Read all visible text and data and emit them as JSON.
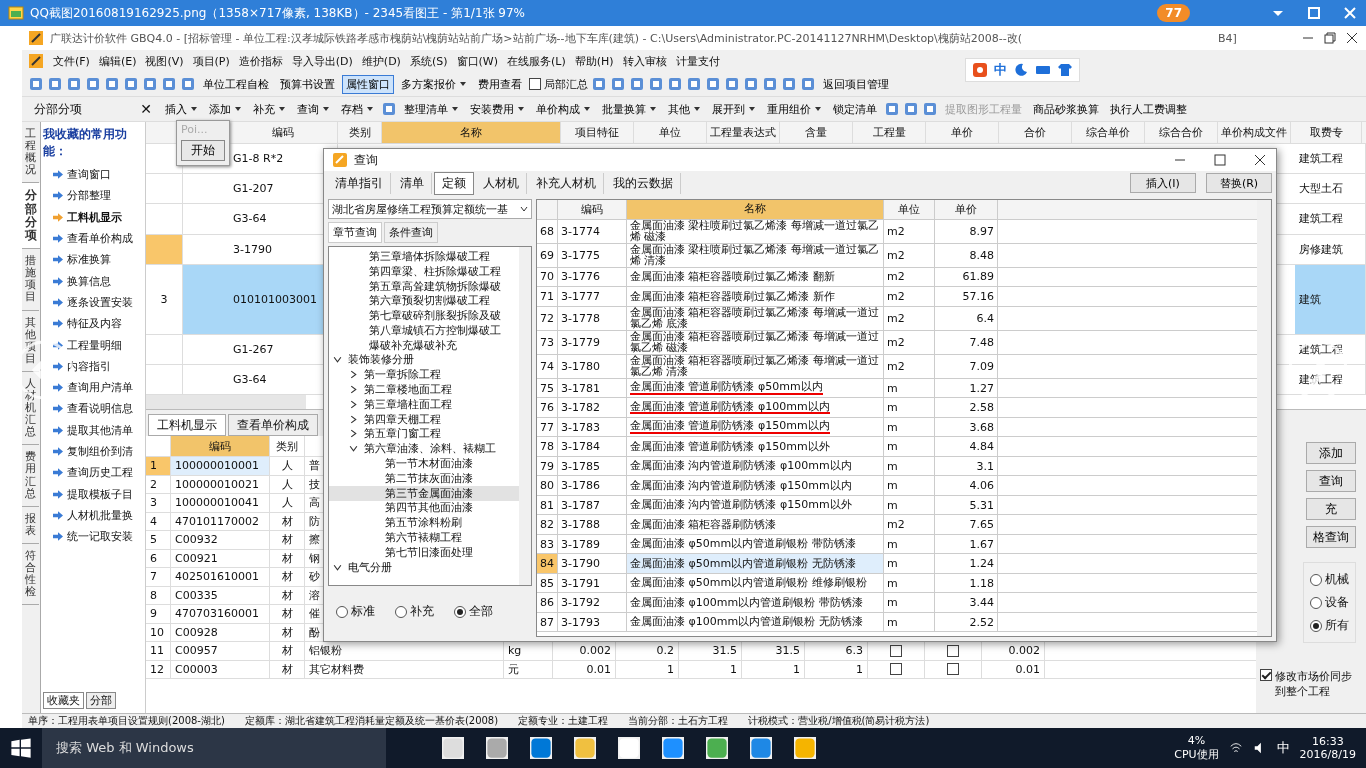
{
  "viewer": {
    "title": "QQ截图20160819162925.png（1358×717像素, 138KB）- 2345看图王 - 第1/1张 97%",
    "badge": "77"
  },
  "app": {
    "title": "广联达计价软件 GBQ4.0 - [招标管理 - 单位工程:汉孝城际铁路孝感市槐荫站\\槐荫站站前广场>站前广场--地下车库(建筑) - C:\\Users\\Administrator.PC-20141127NRHM\\Desktop\\槐荫站2008--改(",
    "title_tail": "B4]"
  },
  "ime": {
    "label": "中"
  },
  "menu": [
    "文件(F)",
    "编辑(E)",
    "视图(V)",
    "项目(P)",
    "造价指标",
    "导入导出(D)",
    "维护(D)",
    "系统(S)",
    "窗口(W)",
    "在线服务(L)",
    "帮助(H)",
    "转入审核",
    "计量支付"
  ],
  "toolbar1": [
    {
      "kind": "icon"
    },
    {
      "kind": "icon"
    },
    {
      "kind": "icon"
    },
    {
      "kind": "icon"
    },
    {
      "kind": "icon"
    },
    {
      "kind": "icon"
    },
    {
      "kind": "icon"
    },
    {
      "kind": "icon"
    },
    {
      "kind": "icon"
    },
    {
      "kind": "button",
      "label": "单位工程自检",
      "selected": false
    },
    {
      "kind": "button",
      "label": "预算书设置",
      "selected": false
    },
    {
      "kind": "button",
      "label": "属性窗口",
      "selected": true
    },
    {
      "kind": "dropdown",
      "label": "多方案报价"
    },
    {
      "kind": "button",
      "label": "费用查看",
      "selected": false
    },
    {
      "kind": "check",
      "label": "局部汇总",
      "checked": false
    },
    {
      "kind": "icon"
    },
    {
      "kind": "icon"
    },
    {
      "kind": "icon"
    },
    {
      "kind": "icon"
    },
    {
      "kind": "icon"
    },
    {
      "kind": "icon"
    },
    {
      "kind": "icon"
    },
    {
      "kind": "icon"
    },
    {
      "kind": "icon"
    },
    {
      "kind": "icon"
    },
    {
      "kind": "icon"
    },
    {
      "kind": "icon"
    },
    {
      "kind": "button",
      "label": "返回项目管理",
      "selected": false
    }
  ],
  "toolbar2": [
    {
      "kind": "dropdown",
      "label": "插入"
    },
    {
      "kind": "dropdown",
      "label": "添加"
    },
    {
      "kind": "dropdown",
      "label": "补充"
    },
    {
      "kind": "dropdown",
      "label": "查询"
    },
    {
      "kind": "dropdown",
      "label": "存档"
    },
    {
      "kind": "icon"
    },
    {
      "kind": "dropdown",
      "label": "整理清单"
    },
    {
      "kind": "dropdown",
      "label": "安装费用"
    },
    {
      "kind": "dropdown",
      "label": "单价构成"
    },
    {
      "kind": "dropdown",
      "label": "批量换算"
    },
    {
      "kind": "dropdown",
      "label": "其他"
    },
    {
      "kind": "dropdown",
      "label": "展开到"
    },
    {
      "kind": "dropdown",
      "label": "重用组价"
    },
    {
      "kind": "button",
      "label": "锁定清单",
      "disabled": false
    },
    {
      "kind": "icon"
    },
    {
      "kind": "icon"
    },
    {
      "kind": "icon"
    },
    {
      "kind": "button",
      "label": "提取图形工程量",
      "disabled": true
    },
    {
      "kind": "button",
      "label": "商品砂浆换算",
      "disabled": false
    },
    {
      "kind": "button",
      "label": "执行人工费调整",
      "disabled": false
    }
  ],
  "vtabs": [
    {
      "label": "工程概况",
      "selected": false
    },
    {
      "label": "分部分项",
      "selected": true
    },
    {
      "label": "措施项目",
      "selected": false
    },
    {
      "label": "其他项目",
      "selected": false
    },
    {
      "label": "人材机汇总",
      "selected": false
    },
    {
      "label": "费用汇总",
      "selected": false
    },
    {
      "label": "报表",
      "selected": false
    },
    {
      "label": "符合性检",
      "selected": false
    }
  ],
  "sidebar": {
    "header": "分部分项",
    "close": "✕",
    "favorites_title": "我收藏的常用功能：",
    "items": [
      {
        "label": "查询窗口",
        "selected": false
      },
      {
        "label": "分部整理",
        "selected": false
      },
      {
        "label": "工料机显示",
        "selected": true
      },
      {
        "label": "查看单价构成",
        "selected": false
      },
      {
        "label": "标准换算",
        "selected": false
      },
      {
        "label": "换算信息",
        "selected": false
      },
      {
        "label": "逐条设置安装",
        "selected": false
      },
      {
        "label": "特征及内容",
        "selected": false
      },
      {
        "label": "工程量明细",
        "selected": false
      },
      {
        "label": "内容指引",
        "selected": false
      },
      {
        "label": "查询用户清单",
        "selected": false
      },
      {
        "label": "查看说明信息",
        "selected": false
      },
      {
        "label": "提取其他清单",
        "selected": false
      },
      {
        "label": "复制组价到清",
        "selected": false
      },
      {
        "label": "查询历史工程",
        "selected": false
      },
      {
        "label": "提取模板子目",
        "selected": false
      },
      {
        "label": "人材机批量换",
        "selected": false
      },
      {
        "label": "统一记取安装",
        "selected": false
      }
    ],
    "bottom_tabs": [
      {
        "label": "收藏夹",
        "selected": true
      },
      {
        "label": "分部",
        "selected": false
      }
    ]
  },
  "popup": {
    "title": "Poi...",
    "button": "开始"
  },
  "upper_grid": {
    "columns": [
      "编码",
      "类别",
      "名称",
      "项目特征",
      "单位",
      "工程量表达式",
      "含量",
      "工程量",
      "单价",
      "合价",
      "综合单价",
      "综合合价",
      "单价构成文件",
      "取费专"
    ],
    "rows": [
      {
        "num": "",
        "code": "G1-8 R*2",
        "fee": "建筑工程",
        "selected": false,
        "tall": false,
        "marked": false
      },
      {
        "num": "",
        "code": "G1-207",
        "fee": "大型土石",
        "selected": false,
        "tall": false,
        "marked": false
      },
      {
        "num": "",
        "code": "G3-64",
        "fee": "建筑工程",
        "selected": false,
        "tall": false,
        "marked": false
      },
      {
        "num": "",
        "code": "3-1790",
        "fee": "房修建筑",
        "selected": false,
        "tall": false,
        "marked": true
      },
      {
        "num": "3",
        "code": "010101003001",
        "fee": "建筑",
        "selected": true,
        "tall": true,
        "marked": false
      },
      {
        "num": "",
        "code": "G1-267",
        "fee": "建筑工程",
        "selected": false,
        "tall": false,
        "marked": false
      },
      {
        "num": "",
        "code": "G3-64",
        "fee": "建筑工程",
        "selected": false,
        "tall": false,
        "marked": false
      }
    ]
  },
  "lower_tabs": [
    {
      "label": "工料机显示",
      "selected": true
    },
    {
      "label": "查看单价构成",
      "selected": false
    }
  ],
  "lower_grid": {
    "columns": [
      "编码",
      "类别"
    ],
    "rows": [
      {
        "num": "1",
        "code": "100000010001",
        "type": "人",
        "name": "普",
        "selected": true
      },
      {
        "num": "2",
        "code": "100000010021",
        "type": "人",
        "name": "技",
        "selected": false
      },
      {
        "num": "3",
        "code": "100000010041",
        "type": "人",
        "name": "高",
        "selected": false
      },
      {
        "num": "4",
        "code": "470101170002",
        "type": "材",
        "name": "防",
        "selected": false
      },
      {
        "num": "5",
        "code": "C00932",
        "type": "材",
        "name": "擦",
        "selected": false
      },
      {
        "num": "6",
        "code": "C00921",
        "type": "材",
        "name": "钢",
        "selected": false
      },
      {
        "num": "7",
        "code": "402501610001",
        "type": "材",
        "name": "砂",
        "selected": false
      },
      {
        "num": "8",
        "code": "C00335",
        "type": "材",
        "name": "溶",
        "selected": false
      },
      {
        "num": "9",
        "code": "470703160001",
        "type": "材",
        "name": "催",
        "selected": false
      },
      {
        "num": "10",
        "code": "C00928",
        "type": "材",
        "name": "酚",
        "selected": false
      },
      {
        "num": "11",
        "code": "C00957",
        "type": "材",
        "name": "铝银粉",
        "selected": false,
        "unit": "kg",
        "values": [
          "0.002",
          "0.2",
          "31.5",
          "31.5",
          "6.3"
        ],
        "check_a": false,
        "check_b": false,
        "total": "0.002"
      },
      {
        "num": "12",
        "code": "C00003",
        "type": "材",
        "name": "其它材料费",
        "selected": false,
        "unit": "元",
        "values": [
          "0.01",
          "1",
          "1",
          "1",
          "1"
        ],
        "check_a": false,
        "check_b": false,
        "total": "0.01"
      }
    ]
  },
  "right_panel": {
    "buttons": [
      "添加",
      "查询",
      "充",
      "格查询"
    ],
    "radios": [
      {
        "label": "机械",
        "selected": false
      },
      {
        "label": "设备",
        "selected": false
      },
      {
        "label": "所有",
        "selected": true
      }
    ],
    "sync": {
      "label": "修改市场价同步到整个工程",
      "checked": true
    }
  },
  "status_bar": [
    "单序：工程用表单项目设置规则(2008-湖北)",
    "定额库：湖北省建筑工程消耗量定额及统一基价表(2008)",
    "定额专业：土建工程",
    "当前分部：土石方工程",
    "计税模式：营业税/增值税(简易计税方法)"
  ],
  "dialog": {
    "title": "查询",
    "tabs": [
      {
        "label": "清单指引",
        "selected": false
      },
      {
        "label": "清单",
        "selected": false
      },
      {
        "label": "定额",
        "selected": true
      },
      {
        "label": "人材机",
        "selected": false
      },
      {
        "label": "补充人材机",
        "selected": false
      },
      {
        "label": "我的云数据",
        "selected": false
      }
    ],
    "buttons": [
      "插入(I)",
      "替换(R)"
    ],
    "library": "湖北省房屋修缮工程预算定额统一基",
    "subtabs": [
      {
        "label": "章节查询",
        "selected": true
      },
      {
        "label": "条件查询",
        "selected": false
      }
    ],
    "tree_above": [
      "第三章墙体拆除爆破工程",
      "第四章梁、柱拆除爆破工程",
      "第五章高耸建筑物拆除爆破",
      "第六章预裂切割爆破工程",
      "第七章破碎剂胀裂拆除及破",
      "第八章城镇石方控制爆破工",
      "爆破补充爆破补充"
    ],
    "tree": [
      {
        "label": "装饰装修分册",
        "expanded": true,
        "children": [
          {
            "label": "第一章拆除工程",
            "expanded": false
          },
          {
            "label": "第二章楼地面工程",
            "expanded": false
          },
          {
            "label": "第三章墙柱面工程",
            "expanded": false
          },
          {
            "label": "第四章天棚工程",
            "expanded": false
          },
          {
            "label": "第五章门窗工程",
            "expanded": false
          },
          {
            "label": "第六章油漆、涂料、裱糊工",
            "expanded": true,
            "children": [
              {
                "label": "第一节木材面油漆",
                "selected": false
              },
              {
                "label": "第二节抹灰面油漆",
                "selected": false
              },
              {
                "label": "第三节金属面油漆",
                "selected": true
              },
              {
                "label": "第四节其他面油漆",
                "selected": false
              },
              {
                "label": "第五节涂料粉刷",
                "selected": false
              },
              {
                "label": "第六节裱糊工程",
                "selected": false
              },
              {
                "label": "第七节旧漆面处理",
                "selected": false
              }
            ]
          }
        ]
      },
      {
        "label": "电气分册",
        "expanded": true
      }
    ],
    "filters": [
      {
        "label": "标准",
        "selected": false
      },
      {
        "label": "补充",
        "selected": false
      },
      {
        "label": "全部",
        "selected": true
      }
    ],
    "columns": [
      "编码",
      "名称",
      "单位",
      "单价"
    ],
    "rows": [
      {
        "num": "68",
        "code": "3-1774",
        "name": "金属面油漆 梁柱喷刷过氯乙烯漆 每增减一道过氯乙烯 磁漆",
        "unit": "m2",
        "price": "8.97",
        "selected": false,
        "marked": false
      },
      {
        "num": "69",
        "code": "3-1775",
        "name": "金属面油漆 梁柱喷刷过氯乙烯漆 每增减一道过氯乙烯 清漆",
        "unit": "m2",
        "price": "8.48",
        "selected": false,
        "marked": false
      },
      {
        "num": "70",
        "code": "3-1776",
        "name": "金属面油漆 箱柜容器喷刷过氯乙烯漆 翻新",
        "unit": "m2",
        "price": "61.89",
        "selected": false,
        "marked": false
      },
      {
        "num": "71",
        "code": "3-1777",
        "name": "金属面油漆 箱柜容器喷刷过氯乙烯漆 新作",
        "unit": "m2",
        "price": "57.16",
        "selected": false,
        "marked": false
      },
      {
        "num": "72",
        "code": "3-1778",
        "name": "金属面油漆 箱柜容器喷刷过氯乙烯漆 每增减一道过氯乙烯 底漆",
        "unit": "m2",
        "price": "6.4",
        "selected": false,
        "marked": false
      },
      {
        "num": "73",
        "code": "3-1779",
        "name": "金属面油漆 箱柜容器喷刷过氯乙烯漆 每增减一道过氯乙烯 磁漆",
        "unit": "m2",
        "price": "7.48",
        "selected": false,
        "marked": false
      },
      {
        "num": "74",
        "code": "3-1780",
        "name": "金属面油漆 箱柜容器喷刷过氯乙烯漆 每增减一道过氯乙烯 清漆",
        "unit": "m2",
        "price": "7.09",
        "selected": false,
        "marked": false
      },
      {
        "num": "75",
        "code": "3-1781",
        "name": "金属面油漆 管道刷防锈漆 φ50mm以内",
        "unit": "m",
        "price": "1.27",
        "selected": false,
        "marked": true
      },
      {
        "num": "76",
        "code": "3-1782",
        "name": "金属面油漆 管道刷防锈漆 φ100mm以内",
        "unit": "m",
        "price": "2.58",
        "selected": false,
        "marked": true
      },
      {
        "num": "77",
        "code": "3-1783",
        "name": "金属面油漆 管道刷防锈漆 φ150mm以内",
        "unit": "m",
        "price": "3.68",
        "selected": false,
        "marked": true
      },
      {
        "num": "78",
        "code": "3-1784",
        "name": "金属面油漆 管道刷防锈漆 φ150mm以外",
        "unit": "m",
        "price": "4.84",
        "selected": false,
        "marked": false
      },
      {
        "num": "79",
        "code": "3-1785",
        "name": "金属面油漆 沟内管道刷防锈漆 φ100mm以内",
        "unit": "m",
        "price": "3.1",
        "selected": false,
        "marked": false
      },
      {
        "num": "80",
        "code": "3-1786",
        "name": "金属面油漆 沟内管道刷防锈漆 φ150mm以内",
        "unit": "m",
        "price": "4.06",
        "selected": false,
        "marked": false
      },
      {
        "num": "81",
        "code": "3-1787",
        "name": "金属面油漆 沟内管道刷防锈漆 φ150mm以外",
        "unit": "m",
        "price": "5.31",
        "selected": false,
        "marked": false
      },
      {
        "num": "82",
        "code": "3-1788",
        "name": "金属面油漆 箱柜容器刷防锈漆",
        "unit": "m2",
        "price": "7.65",
        "selected": false,
        "marked": false
      },
      {
        "num": "83",
        "code": "3-1789",
        "name": "金属面油漆 φ50mm以内管道刷银粉 带防锈漆",
        "unit": "m",
        "price": "1.67",
        "selected": false,
        "marked": false
      },
      {
        "num": "84",
        "code": "3-1790",
        "name": "金属面油漆 φ50mm以内管道刷银粉 无防锈漆",
        "unit": "m",
        "price": "1.24",
        "selected": true,
        "marked": false
      },
      {
        "num": "85",
        "code": "3-1791",
        "name": "金属面油漆 φ50mm以内管道刷银粉 维修刷银粉",
        "unit": "m",
        "price": "1.18",
        "selected": false,
        "marked": false
      },
      {
        "num": "86",
        "code": "3-1792",
        "name": "金属面油漆 φ100mm以内管道刷银粉 带防锈漆",
        "unit": "m",
        "price": "3.44",
        "selected": false,
        "marked": false
      },
      {
        "num": "87",
        "code": "3-1793",
        "name": "金属面油漆 φ100mm以内管道刷银粉 无防锈漆",
        "unit": "m",
        "price": "2.52",
        "selected": false,
        "marked": false
      }
    ]
  },
  "taskbar": {
    "search": "搜索 Web 和 Windows",
    "cpu": "4%",
    "cpu_label": "CPU使用",
    "ime": "中",
    "time": "16:33",
    "date": "2016/8/19"
  }
}
